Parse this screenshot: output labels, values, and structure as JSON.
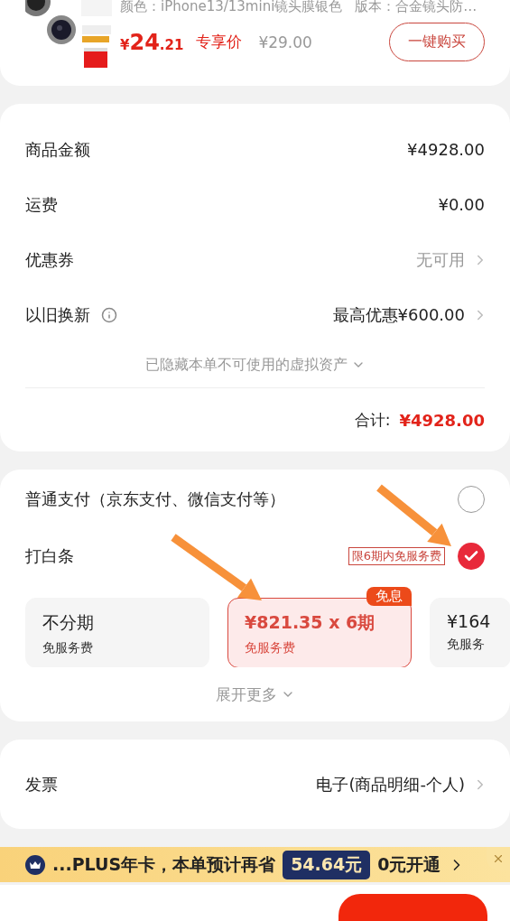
{
  "product": {
    "spec_color": "颜色：iPhone13/13mini镜头膜银色",
    "spec_version": "版本：合金镜头防…",
    "price_symbol": "¥",
    "price_int": "24",
    "price_dec": ".21",
    "price_tag": "专享价",
    "original_price": "¥29.00",
    "buy_button": "一键购买"
  },
  "summary": {
    "rows": [
      {
        "kind": "plain",
        "label": "商品金额",
        "value": "¥4928.00"
      },
      {
        "kind": "plain",
        "label": "运费",
        "value": "¥0.00"
      },
      {
        "kind": "muted_link",
        "label": "优惠券",
        "value": "无可用"
      },
      {
        "kind": "info_link",
        "label": "以旧换新",
        "value": "最高优惠¥600.00"
      }
    ],
    "hidden_note": "已隐藏本单不可使用的虚拟资产",
    "total_label": "合计:",
    "total_value": "¥4928.00"
  },
  "payment": {
    "methods": [
      {
        "label": "普通支付（京东支付、微信支付等）",
        "selected": false
      },
      {
        "label": "打白条",
        "tag": "限6期内免服务费",
        "selected": true
      }
    ],
    "installments": [
      {
        "title": "不分期",
        "subtitle": "免服务费",
        "selected": false
      },
      {
        "title": "¥821.35 x 6期",
        "subtitle": "免服务费",
        "badge": "免息",
        "selected": true
      },
      {
        "title": "¥164",
        "subtitle": "免服务",
        "selected": false
      }
    ],
    "expand": "展开更多"
  },
  "invoice": {
    "label": "发票",
    "value": "电子(商品明细-个人)"
  },
  "plus_banner": {
    "text": "...PLUS年卡，本单预计再省",
    "savings": "54.64元",
    "cta": "0元开通"
  }
}
